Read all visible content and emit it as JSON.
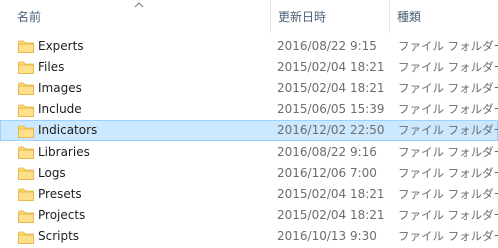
{
  "header": {
    "name_label": "名前",
    "date_label": "更新日時",
    "type_label": "種類",
    "sort_icon": "chevron-up-icon"
  },
  "rows": [
    {
      "name": "Experts",
      "date": "2016/08/22 9:15",
      "type": "ファイル フォルダー",
      "selected": false
    },
    {
      "name": "Files",
      "date": "2015/02/04 18:21",
      "type": "ファイル フォルダー",
      "selected": false
    },
    {
      "name": "Images",
      "date": "2015/02/04 18:21",
      "type": "ファイル フォルダー",
      "selected": false
    },
    {
      "name": "Include",
      "date": "2015/06/05 15:39",
      "type": "ファイル フォルダー",
      "selected": false
    },
    {
      "name": "Indicators",
      "date": "2016/12/02 22:50",
      "type": "ファイル フォルダー",
      "selected": true
    },
    {
      "name": "Libraries",
      "date": "2016/08/22 9:16",
      "type": "ファイル フォルダー",
      "selected": false
    },
    {
      "name": "Logs",
      "date": "2016/12/06 7:00",
      "type": "ファイル フォルダー",
      "selected": false
    },
    {
      "name": "Presets",
      "date": "2015/02/04 18:21",
      "type": "ファイル フォルダー",
      "selected": false
    },
    {
      "name": "Projects",
      "date": "2015/02/04 18:21",
      "type": "ファイル フォルダー",
      "selected": false
    },
    {
      "name": "Scripts",
      "date": "2016/10/13 9:30",
      "type": "ファイル フォルダー",
      "selected": false
    }
  ],
  "colors": {
    "selection_bg": "#cce8ff",
    "selection_border": "#99d1ff",
    "folder": "#ffd868",
    "header_text": "#4c607a"
  }
}
